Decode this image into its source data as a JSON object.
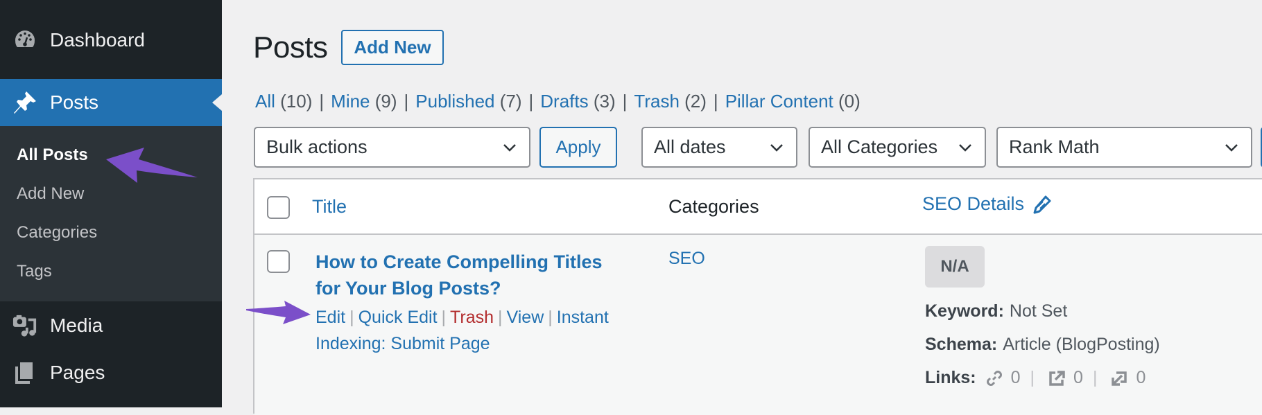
{
  "sidebar": {
    "items": [
      {
        "label": "Dashboard",
        "icon": "dashboard-icon"
      },
      {
        "label": "Posts",
        "icon": "pushpin-icon",
        "active": true
      },
      {
        "label": "Media",
        "icon": "media-icon"
      },
      {
        "label": "Pages",
        "icon": "pages-icon"
      }
    ],
    "submenu": [
      {
        "label": "All Posts",
        "current": true
      },
      {
        "label": "Add New"
      },
      {
        "label": "Categories"
      },
      {
        "label": "Tags"
      }
    ]
  },
  "header": {
    "title": "Posts",
    "add_new_label": "Add New"
  },
  "views": [
    {
      "label": "All",
      "count": "(10)"
    },
    {
      "label": "Mine",
      "count": "(9)"
    },
    {
      "label": "Published",
      "count": "(7)"
    },
    {
      "label": "Drafts",
      "count": "(3)"
    },
    {
      "label": "Trash",
      "count": "(2)"
    },
    {
      "label": "Pillar Content",
      "count": "(0)"
    }
  ],
  "filters": {
    "bulk_actions": "Bulk actions",
    "apply_label": "Apply",
    "dates": "All dates",
    "categories": "All Categories",
    "seo_filter": "Rank Math"
  },
  "table": {
    "columns": {
      "title": "Title",
      "categories": "Categories",
      "seo": "SEO Details"
    },
    "rows": [
      {
        "title": "How to Create Compelling Titles for Your Blog Posts?",
        "actions": {
          "edit": "Edit",
          "quick_edit": "Quick Edit",
          "trash": "Trash",
          "view": "View",
          "instant_indexing": "Instant Indexing: Submit Page"
        },
        "category": "SEO",
        "seo": {
          "score": "N/A",
          "keyword_label": "Keyword:",
          "keyword_value": "Not Set",
          "schema_label": "Schema:",
          "schema_value": "Article (BlogPosting)",
          "links_label": "Links:",
          "internal_links": "0",
          "external_links": "0",
          "incoming_links": "0"
        }
      }
    ]
  },
  "colors": {
    "accent": "#2271b1",
    "sidebar_bg": "#1d2327",
    "submenu_bg": "#2c3338",
    "trash_red": "#b32d2e",
    "annotation_arrow": "#7b4fc9"
  }
}
